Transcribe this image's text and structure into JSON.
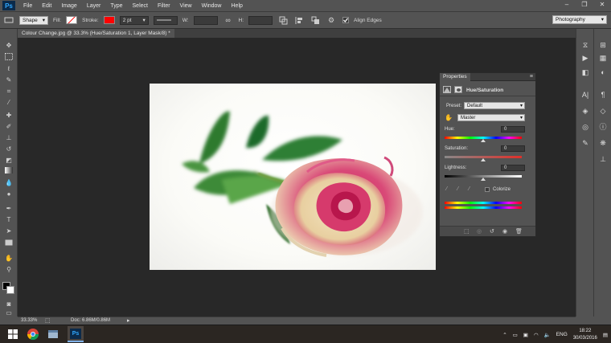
{
  "menubar": {
    "logo": "Ps",
    "items": [
      "File",
      "Edit",
      "Image",
      "Layer",
      "Type",
      "Select",
      "Filter",
      "View",
      "Window",
      "Help"
    ],
    "window_controls": [
      "–",
      "❐",
      "✕"
    ]
  },
  "options_bar": {
    "shape_mode": "Shape",
    "fill_label": "Fill:",
    "stroke_label": "Stroke:",
    "stroke_color": "#ff0000",
    "stroke_width": "2 pt",
    "w_label": "W:",
    "h_label": "H:",
    "align_edges_label": "Align Edges",
    "align_edges_checked": true,
    "workspace": "Photography"
  },
  "document": {
    "tab_title": "Colour Change.jpg @ 33.3% (Hue/Saturation 1, Layer Mask/8) *",
    "zoom": "33.33%",
    "doc_info": "Doc: 6.86M/0.86M"
  },
  "properties": {
    "title": "Properties",
    "adjustment_name": "Hue/Saturation",
    "preset_label": "Preset:",
    "preset_value": "Default",
    "channel_value": "Master",
    "hue_label": "Hue:",
    "hue_value": "0",
    "saturation_label": "Saturation:",
    "saturation_value": "0",
    "lightness_label": "Lightness:",
    "lightness_value": "0",
    "colorize_label": "Colorize",
    "colorize_checked": false
  },
  "taskbar": {
    "language": "ENG",
    "time": "18:22",
    "date": "30/03/2016"
  },
  "colors": {
    "ui_bg": "#535353",
    "canvas_bg": "#282828",
    "ps_blue": "#31a8ff"
  }
}
